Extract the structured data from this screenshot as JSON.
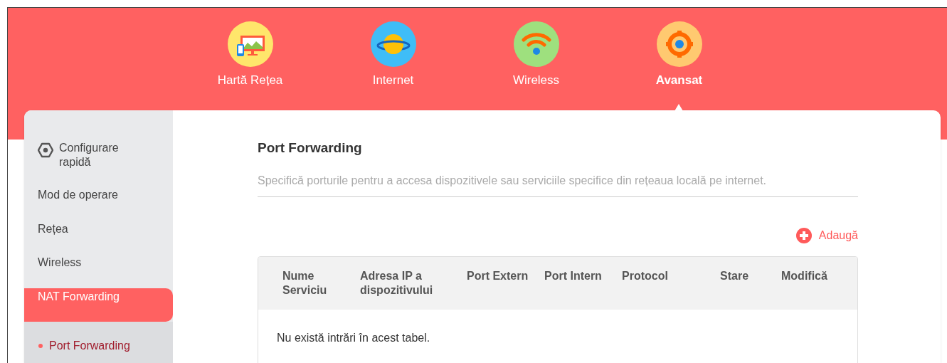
{
  "top_nav": [
    {
      "kind": "map",
      "label": "Hartă Rețea",
      "selected": false
    },
    {
      "kind": "internet",
      "label": "Internet",
      "selected": false
    },
    {
      "kind": "wireless",
      "label": "Wireless",
      "selected": false
    },
    {
      "kind": "advanced",
      "label": "Avansat",
      "selected": true
    }
  ],
  "sidebar": {
    "items": [
      {
        "kind": "quick",
        "label": "Configurare rapidă",
        "selected": false
      },
      {
        "kind": "item",
        "label": "Mod de operare",
        "selected": false
      },
      {
        "kind": "item",
        "label": "Rețea",
        "selected": false
      },
      {
        "kind": "item",
        "label": "Wireless",
        "selected": false
      },
      {
        "kind": "item",
        "label": "NAT Forwarding",
        "selected": true,
        "children": [
          {
            "label": "Port Forwarding",
            "selected": true
          }
        ]
      }
    ]
  },
  "content": {
    "title": "Port Forwarding",
    "description": "Specifică porturile pentru a accesa dispozitivele sau serviciile specifice din rețeaua locală pe internet.",
    "add_button": "Adaugă",
    "table": {
      "columns": [
        "Nume Serviciu",
        "Adresa IP a dispozitivului",
        "Port Extern",
        "Port Intern",
        "Protocol",
        "Stare",
        "Modifică"
      ],
      "empty_message": "Nu există intrări în acest tabel."
    }
  }
}
